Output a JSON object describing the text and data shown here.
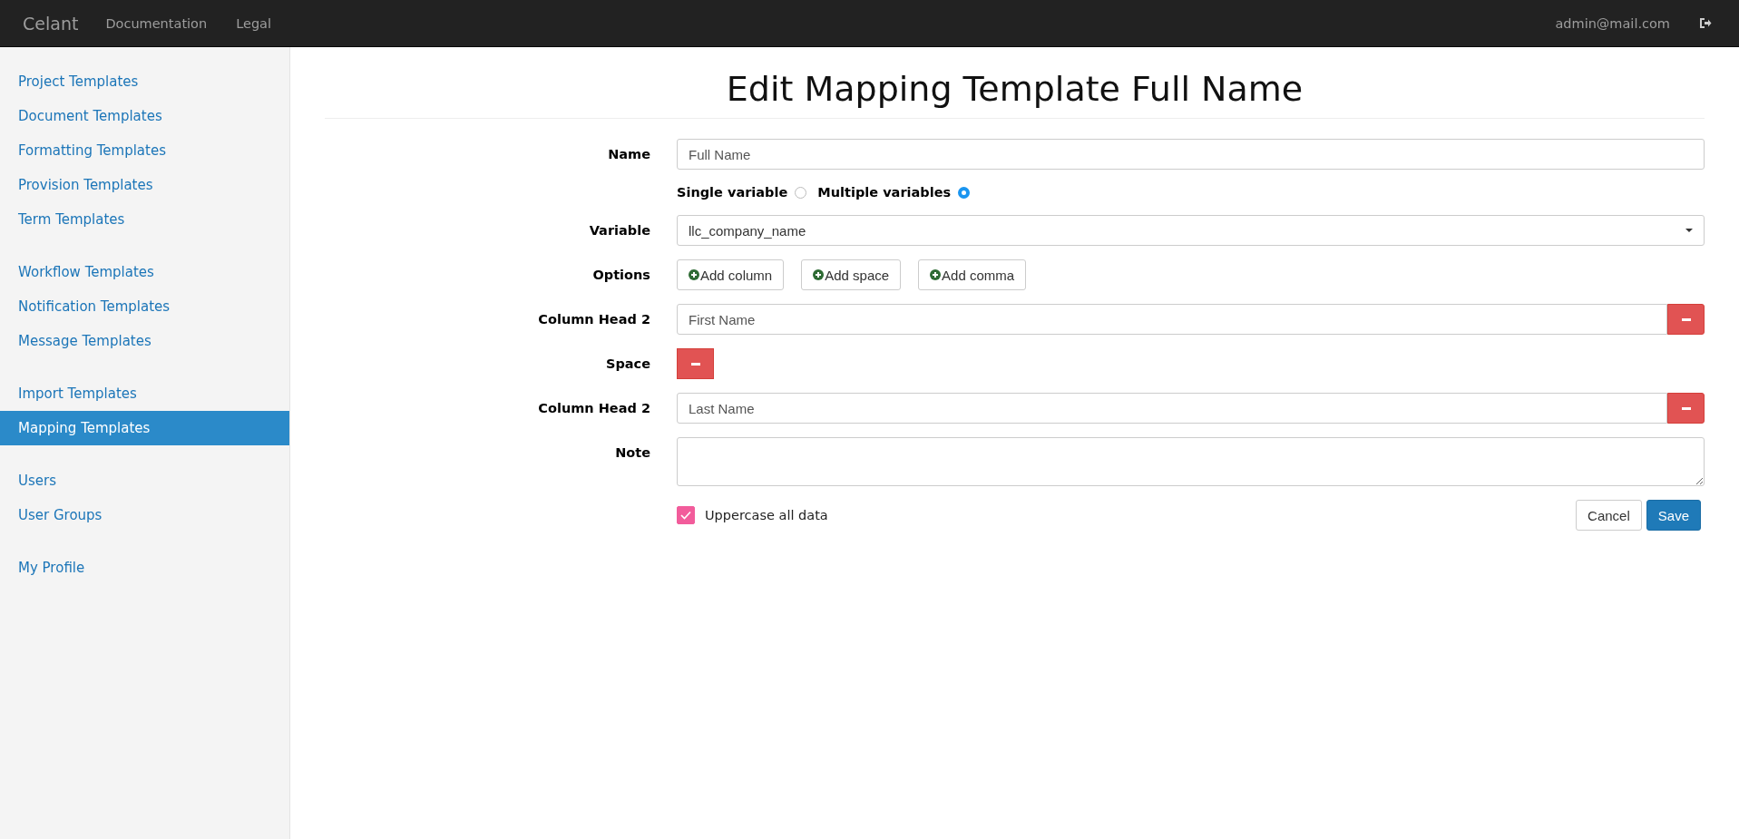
{
  "navbar": {
    "brand": "Celant",
    "links": [
      "Documentation",
      "Legal"
    ],
    "user": "admin@mail.com"
  },
  "sidebar": {
    "groups": [
      {
        "items": [
          {
            "label": "Project Templates",
            "selected": false
          },
          {
            "label": "Document Templates",
            "selected": false
          },
          {
            "label": "Formatting Templates",
            "selected": false
          },
          {
            "label": "Provision Templates",
            "selected": false
          },
          {
            "label": "Term Templates",
            "selected": false
          }
        ]
      },
      {
        "items": [
          {
            "label": "Workflow Templates",
            "selected": false
          },
          {
            "label": "Notification Templates",
            "selected": false
          },
          {
            "label": "Message Templates",
            "selected": false
          }
        ]
      },
      {
        "items": [
          {
            "label": "Import Templates",
            "selected": false
          },
          {
            "label": "Mapping Templates",
            "selected": true
          }
        ]
      },
      {
        "items": [
          {
            "label": "Users",
            "selected": false
          },
          {
            "label": "User Groups",
            "selected": false
          }
        ]
      },
      {
        "items": [
          {
            "label": "My Profile",
            "selected": false
          }
        ]
      }
    ]
  },
  "page": {
    "title": "Edit Mapping Template Full Name"
  },
  "form": {
    "rows": [
      {
        "kind": "input",
        "label": "Name",
        "value": "Full Name"
      },
      {
        "kind": "radio",
        "options": [
          {
            "label": "Single variable",
            "selected": false
          },
          {
            "label": "Multiple variables",
            "selected": true
          }
        ]
      },
      {
        "kind": "select",
        "label": "Variable",
        "value": "llc_company_name"
      },
      {
        "kind": "buttons",
        "label": "Options",
        "buttons": [
          "Add column",
          "Add space",
          "Add comma"
        ]
      },
      {
        "kind": "input-remove",
        "label": "Column Head 2",
        "value": "First Name"
      },
      {
        "kind": "remove",
        "label": "Space"
      },
      {
        "kind": "input-remove",
        "label": "Column Head 2",
        "value": "Last Name"
      },
      {
        "kind": "textarea",
        "label": "Note"
      }
    ],
    "uppercase": {
      "label": "Uppercase all data",
      "checked": true
    },
    "actions": {
      "cancel": "Cancel",
      "save": "Save"
    }
  }
}
